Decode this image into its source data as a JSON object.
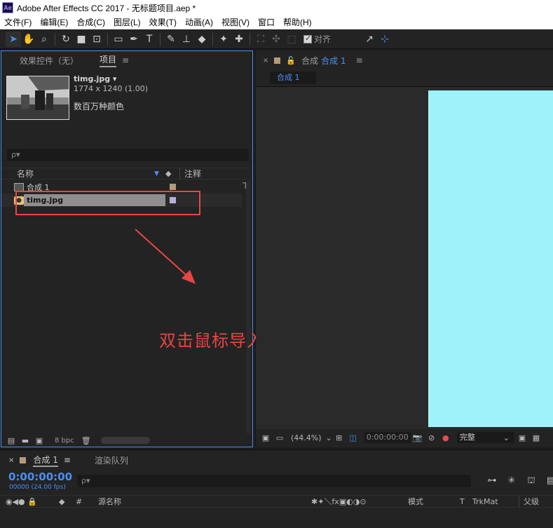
{
  "window": {
    "title": "Adobe After Effects CC 2017 - 无标题项目.aep *",
    "logo": "Ae"
  },
  "menu": [
    "文件(F)",
    "编辑(E)",
    "合成(C)",
    "图层(L)",
    "效果(T)",
    "动画(A)",
    "视图(V)",
    "窗口",
    "帮助(H)"
  ],
  "toolbar": {
    "snap_label": "对齐",
    "snap_checked": true
  },
  "project_panel": {
    "tabs": [
      {
        "label": "效果控件（无）",
        "active": false
      },
      {
        "label": "项目",
        "active": true
      }
    ],
    "menu_glyph": "≡",
    "preview": {
      "name": "timg.jpg ▾",
      "dimensions": "1774 x 1240 (1.00)",
      "colors": "数百万种颜色"
    },
    "search_placeholder": "ρ▾",
    "columns": {
      "name": "名称",
      "comment": "注释"
    },
    "items": [
      {
        "name": "合成 1",
        "type": "composition",
        "label_color": "#b59a79"
      },
      {
        "name": "timg.jpg",
        "type": "footage",
        "label_color": "#b4b1d8",
        "selected": true
      }
    ],
    "footer": {
      "bpc": "8 bpc"
    }
  },
  "annotation": {
    "text": "双击鼠标导入素材",
    "color": "#e84545"
  },
  "comp_panel": {
    "tab_prefix": "合成",
    "tab_active": "合成 1",
    "subtab": "合成 1",
    "canvas_color": "#9ef3fb",
    "footer": {
      "zoom": "(44.4%)",
      "timecode": "0:00:00:00",
      "resolution": "完整"
    }
  },
  "timeline": {
    "tab_comp": "合成 1",
    "tab_render": "渲染队列",
    "timecode": "0:00:00:00",
    "fps": "00000 (24.00 fps)",
    "search_placeholder": "ρ▾",
    "columns": {
      "num": "#",
      "source_name": "源名称",
      "mode": "模式",
      "t": "T",
      "trkmat": "TrkMat",
      "parent": "父级"
    }
  }
}
